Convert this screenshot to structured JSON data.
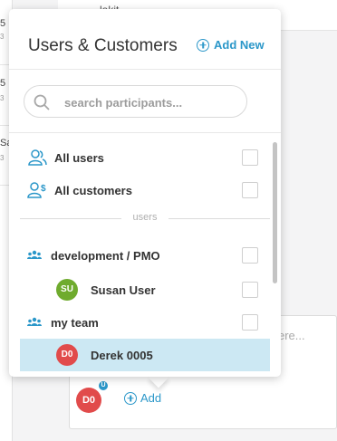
{
  "background": {
    "left_fragments": [
      "5",
      "3",
      "5",
      "3",
      "Sa",
      "3"
    ],
    "top_fragment": "...lakit",
    "card_placeholder": "ere...",
    "avatar_initials": "D0",
    "avatar_badge": "U",
    "add_label": "Add"
  },
  "popover": {
    "title": "Users & Customers",
    "add_new_label": "Add New",
    "search": {
      "placeholder": "search participants..."
    },
    "items": {
      "all_users": "All users",
      "all_customers": "All customers",
      "divider": "users",
      "group_dev": "development / PMO",
      "susan": {
        "initials": "SU",
        "name": "Susan User"
      },
      "group_team": "my team",
      "derek": {
        "initials": "D0",
        "name": "Derek 0005"
      }
    }
  },
  "colors": {
    "accent": "#2b97c9",
    "selected_row": "#cce8f3",
    "avatar_green": "#6fab2e",
    "avatar_red": "#e14b4b"
  },
  "icons": [
    "add-circle-icon",
    "search-icon",
    "user-icon",
    "customer-icon",
    "group-icon",
    "checkbox"
  ]
}
